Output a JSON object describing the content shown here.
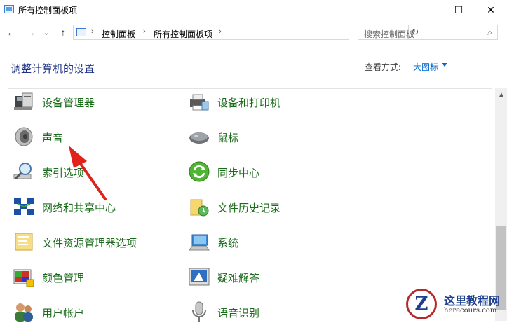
{
  "window": {
    "title": "所有控制面板项",
    "minimize_glyph": "—",
    "maximize_glyph": "☐",
    "close_glyph": "✕"
  },
  "address_bar": {
    "back_glyph": "←",
    "forward_glyph": "→",
    "history_glyph": "⌄",
    "up_glyph": "↑",
    "sep_glyph": "›",
    "breadcrumbs": [
      "控制面板",
      "所有控制面板项"
    ],
    "dropdown_glyph": "⌄",
    "refresh_glyph": "↻"
  },
  "search": {
    "placeholder": "搜索控制面板",
    "icon_glyph": "⌕"
  },
  "header": {
    "title": "调整计算机的设置",
    "view_by_label": "查看方式:",
    "view_by_value": "大图标"
  },
  "items": [
    {
      "label": "设备管理器",
      "icon": "device-manager-icon"
    },
    {
      "label": "设备和打印机",
      "icon": "devices-printers-icon"
    },
    {
      "label": "声音",
      "icon": "sound-icon"
    },
    {
      "label": "鼠标",
      "icon": "mouse-icon"
    },
    {
      "label": "索引选项",
      "icon": "indexing-icon"
    },
    {
      "label": "同步中心",
      "icon": "sync-center-icon"
    },
    {
      "label": "网络和共享中心",
      "icon": "network-icon"
    },
    {
      "label": "文件历史记录",
      "icon": "file-history-icon"
    },
    {
      "label": "文件资源管理器选项",
      "icon": "explorer-options-icon"
    },
    {
      "label": "系统",
      "icon": "system-icon"
    },
    {
      "label": "颜色管理",
      "icon": "color-management-icon"
    },
    {
      "label": "疑难解答",
      "icon": "troubleshooting-icon"
    },
    {
      "label": "用户帐户",
      "icon": "user-accounts-icon"
    },
    {
      "label": "语音识别",
      "icon": "speech-recognition-icon"
    }
  ],
  "scrollbar": {
    "up_glyph": "▲"
  },
  "watermark": {
    "logo_letter": "Z",
    "title": "这里教程网",
    "subtitle": "herecours.com"
  },
  "colors": {
    "link_green": "#1a6b1a",
    "heading_blue": "#1e3287",
    "annotation_red": "#e0221b"
  }
}
